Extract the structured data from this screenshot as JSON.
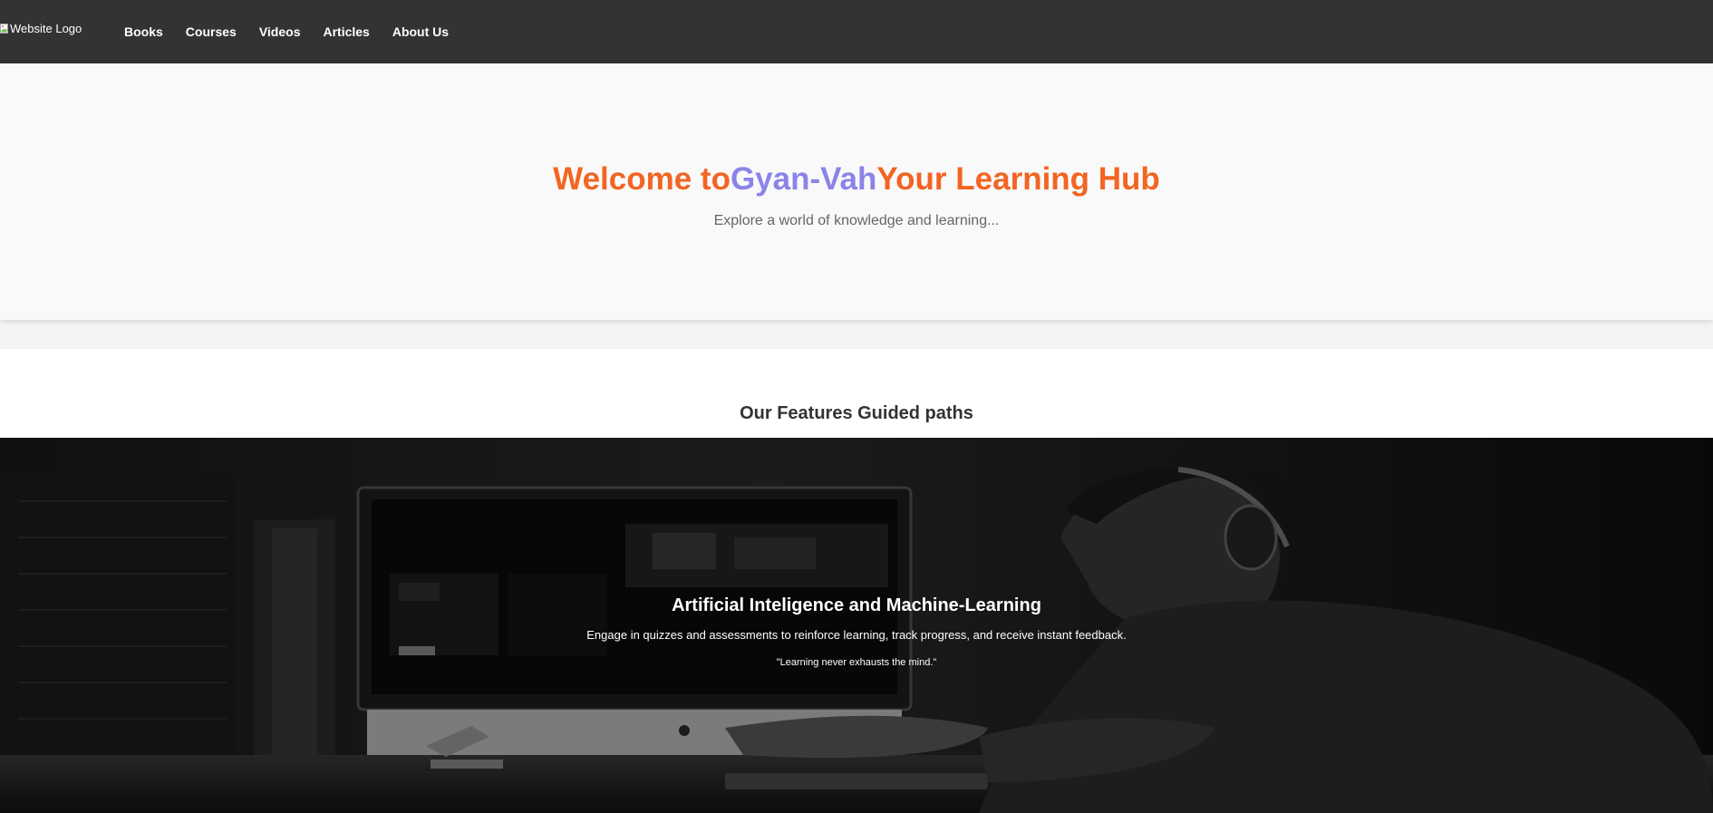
{
  "navbar": {
    "logo_alt": "Website Logo",
    "links": [
      "Books",
      "Courses",
      "Videos",
      "Articles",
      "About Us"
    ]
  },
  "hero": {
    "title_part1": "Welcome to",
    "title_part2": "Gyan-Vah",
    "title_part3": "Your Learning Hub",
    "subtitle": "Explore a world of knowledge and learning..."
  },
  "features": {
    "title": "Our Features Guided paths"
  },
  "banner": {
    "title": "Artificial Inteligence and Machine-Learning",
    "description": "Engage in quizzes and assessments to reinforce learning, track progress, and receive instant feedback.",
    "quote": "\"Learning never exhausts the mind.\""
  },
  "colors": {
    "navbar_bg": "#333333",
    "accent_orange": "#f26522",
    "accent_purple": "#8b84e8",
    "subtitle_gray": "#666666"
  },
  "icons": {
    "logo": "broken-image-icon"
  }
}
